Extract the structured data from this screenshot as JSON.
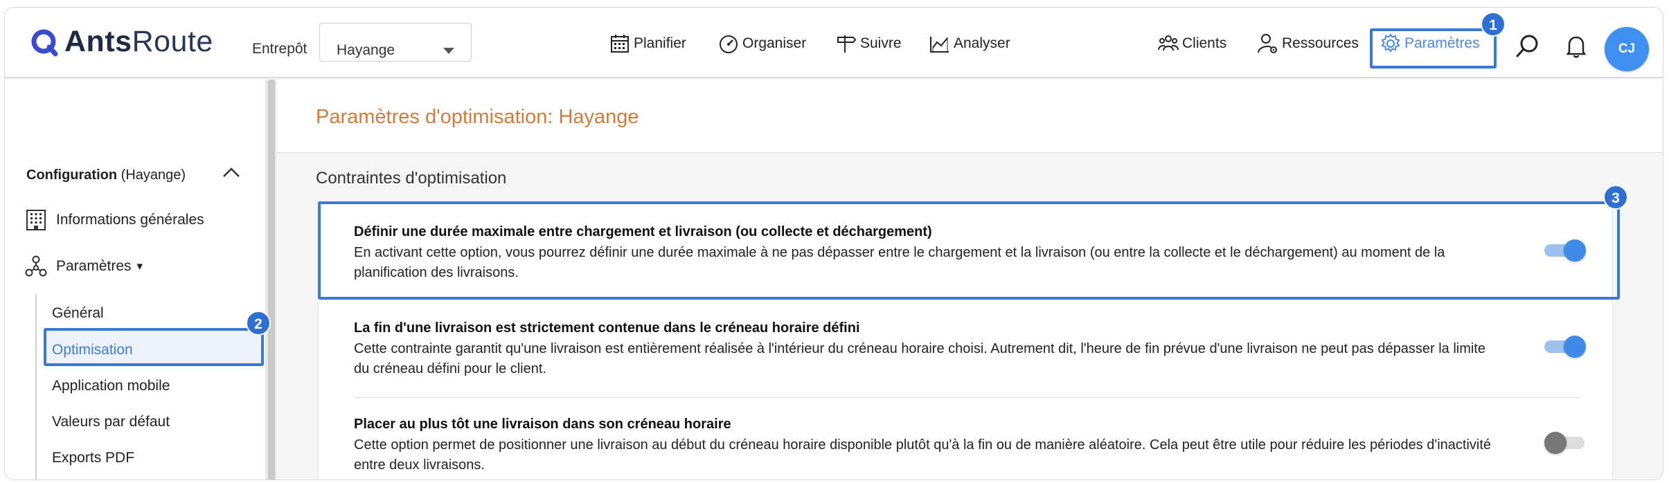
{
  "header": {
    "logo_bold": "Ants",
    "logo_light": "Route",
    "warehouse_label": "Entrepôt",
    "warehouse_value": "Hayange",
    "nav": [
      {
        "label": "Planifier",
        "icon": "calendar-icon"
      },
      {
        "label": "Organiser",
        "icon": "speedometer-icon"
      },
      {
        "label": "Suivre",
        "icon": "signpost-icon"
      },
      {
        "label": "Analyser",
        "icon": "chart-icon"
      }
    ],
    "right_nav": [
      {
        "label": "Clients",
        "icon": "people-icon"
      },
      {
        "label": "Ressources",
        "icon": "user-gear-icon"
      },
      {
        "label": "Paramètres",
        "icon": "gear-icon"
      }
    ],
    "avatar_initials": "CJ",
    "badge_params": "1"
  },
  "sidebar": {
    "config_label": "Configuration",
    "config_context": "(Hayange)",
    "items": [
      {
        "label": "Informations générales",
        "icon": "building-icon"
      },
      {
        "label": "Paramètres",
        "icon": "network-icon",
        "suffix": "▾"
      }
    ],
    "sub_items": [
      {
        "label": "Général"
      },
      {
        "label": "Optimisation",
        "active": true
      },
      {
        "label": "Application mobile"
      },
      {
        "label": "Valeurs par défaut"
      },
      {
        "label": "Exports PDF"
      }
    ],
    "badge_optimisation": "2"
  },
  "main": {
    "page_title": "Paramètres d'optimisation: Hayange",
    "section_title": "Contraintes d'optimisation",
    "badge_row": "3",
    "rows": [
      {
        "title": "Définir une durée maximale entre chargement et livraison (ou collecte et déchargement)",
        "desc": "En activant cette option, vous pourrez définir une durée maximale à ne pas dépasser entre le chargement et la livraison (ou entre la collecte et le déchargement) au moment de la planification des livraisons.",
        "enabled": true
      },
      {
        "title": "La fin d'une livraison est strictement contenue dans le créneau horaire défini",
        "desc": "Cette contrainte garantit qu'une livraison est entièrement réalisée à l'intérieur du créneau horaire choisi. Autrement dit, l'heure de fin prévue d'une livraison ne peut pas dépasser la limite du créneau défini pour le client.",
        "enabled": true
      },
      {
        "title": "Placer au plus tôt une livraison dans son créneau horaire",
        "desc": "Cette option permet de positionner une livraison au début du créneau horaire disponible plutôt qu'à la fin ou de manière aléatoire. Cela peut être utile pour réduire les périodes d'inactivité entre deux livraisons.",
        "enabled": false
      }
    ]
  },
  "colors": {
    "accent": "#3a78d6",
    "title_orange": "#d07b3f",
    "toggle_on": "#3f8ae6"
  }
}
